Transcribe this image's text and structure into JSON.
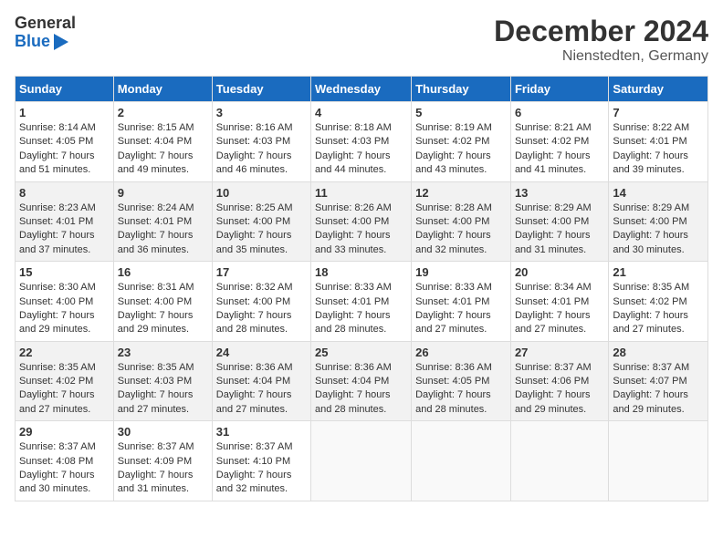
{
  "header": {
    "logo_general": "General",
    "logo_blue": "Blue",
    "title": "December 2024",
    "subtitle": "Nienstedten, Germany"
  },
  "weekdays": [
    "Sunday",
    "Monday",
    "Tuesday",
    "Wednesday",
    "Thursday",
    "Friday",
    "Saturday"
  ],
  "weeks": [
    [
      {
        "day": "1",
        "sunrise": "8:14 AM",
        "sunset": "4:05 PM",
        "daylight": "7 hours and 51 minutes."
      },
      {
        "day": "2",
        "sunrise": "8:15 AM",
        "sunset": "4:04 PM",
        "daylight": "7 hours and 49 minutes."
      },
      {
        "day": "3",
        "sunrise": "8:16 AM",
        "sunset": "4:03 PM",
        "daylight": "7 hours and 46 minutes."
      },
      {
        "day": "4",
        "sunrise": "8:18 AM",
        "sunset": "4:03 PM",
        "daylight": "7 hours and 44 minutes."
      },
      {
        "day": "5",
        "sunrise": "8:19 AM",
        "sunset": "4:02 PM",
        "daylight": "7 hours and 43 minutes."
      },
      {
        "day": "6",
        "sunrise": "8:21 AM",
        "sunset": "4:02 PM",
        "daylight": "7 hours and 41 minutes."
      },
      {
        "day": "7",
        "sunrise": "8:22 AM",
        "sunset": "4:01 PM",
        "daylight": "7 hours and 39 minutes."
      }
    ],
    [
      {
        "day": "8",
        "sunrise": "8:23 AM",
        "sunset": "4:01 PM",
        "daylight": "7 hours and 37 minutes."
      },
      {
        "day": "9",
        "sunrise": "8:24 AM",
        "sunset": "4:01 PM",
        "daylight": "7 hours and 36 minutes."
      },
      {
        "day": "10",
        "sunrise": "8:25 AM",
        "sunset": "4:00 PM",
        "daylight": "7 hours and 35 minutes."
      },
      {
        "day": "11",
        "sunrise": "8:26 AM",
        "sunset": "4:00 PM",
        "daylight": "7 hours and 33 minutes."
      },
      {
        "day": "12",
        "sunrise": "8:28 AM",
        "sunset": "4:00 PM",
        "daylight": "7 hours and 32 minutes."
      },
      {
        "day": "13",
        "sunrise": "8:29 AM",
        "sunset": "4:00 PM",
        "daylight": "7 hours and 31 minutes."
      },
      {
        "day": "14",
        "sunrise": "8:29 AM",
        "sunset": "4:00 PM",
        "daylight": "7 hours and 30 minutes."
      }
    ],
    [
      {
        "day": "15",
        "sunrise": "8:30 AM",
        "sunset": "4:00 PM",
        "daylight": "7 hours and 29 minutes."
      },
      {
        "day": "16",
        "sunrise": "8:31 AM",
        "sunset": "4:00 PM",
        "daylight": "7 hours and 29 minutes."
      },
      {
        "day": "17",
        "sunrise": "8:32 AM",
        "sunset": "4:00 PM",
        "daylight": "7 hours and 28 minutes."
      },
      {
        "day": "18",
        "sunrise": "8:33 AM",
        "sunset": "4:01 PM",
        "daylight": "7 hours and 28 minutes."
      },
      {
        "day": "19",
        "sunrise": "8:33 AM",
        "sunset": "4:01 PM",
        "daylight": "7 hours and 27 minutes."
      },
      {
        "day": "20",
        "sunrise": "8:34 AM",
        "sunset": "4:01 PM",
        "daylight": "7 hours and 27 minutes."
      },
      {
        "day": "21",
        "sunrise": "8:35 AM",
        "sunset": "4:02 PM",
        "daylight": "7 hours and 27 minutes."
      }
    ],
    [
      {
        "day": "22",
        "sunrise": "8:35 AM",
        "sunset": "4:02 PM",
        "daylight": "7 hours and 27 minutes."
      },
      {
        "day": "23",
        "sunrise": "8:35 AM",
        "sunset": "4:03 PM",
        "daylight": "7 hours and 27 minutes."
      },
      {
        "day": "24",
        "sunrise": "8:36 AM",
        "sunset": "4:04 PM",
        "daylight": "7 hours and 27 minutes."
      },
      {
        "day": "25",
        "sunrise": "8:36 AM",
        "sunset": "4:04 PM",
        "daylight": "7 hours and 28 minutes."
      },
      {
        "day": "26",
        "sunrise": "8:36 AM",
        "sunset": "4:05 PM",
        "daylight": "7 hours and 28 minutes."
      },
      {
        "day": "27",
        "sunrise": "8:37 AM",
        "sunset": "4:06 PM",
        "daylight": "7 hours and 29 minutes."
      },
      {
        "day": "28",
        "sunrise": "8:37 AM",
        "sunset": "4:07 PM",
        "daylight": "7 hours and 29 minutes."
      }
    ],
    [
      {
        "day": "29",
        "sunrise": "8:37 AM",
        "sunset": "4:08 PM",
        "daylight": "7 hours and 30 minutes."
      },
      {
        "day": "30",
        "sunrise": "8:37 AM",
        "sunset": "4:09 PM",
        "daylight": "7 hours and 31 minutes."
      },
      {
        "day": "31",
        "sunrise": "8:37 AM",
        "sunset": "4:10 PM",
        "daylight": "7 hours and 32 minutes."
      },
      null,
      null,
      null,
      null
    ]
  ]
}
